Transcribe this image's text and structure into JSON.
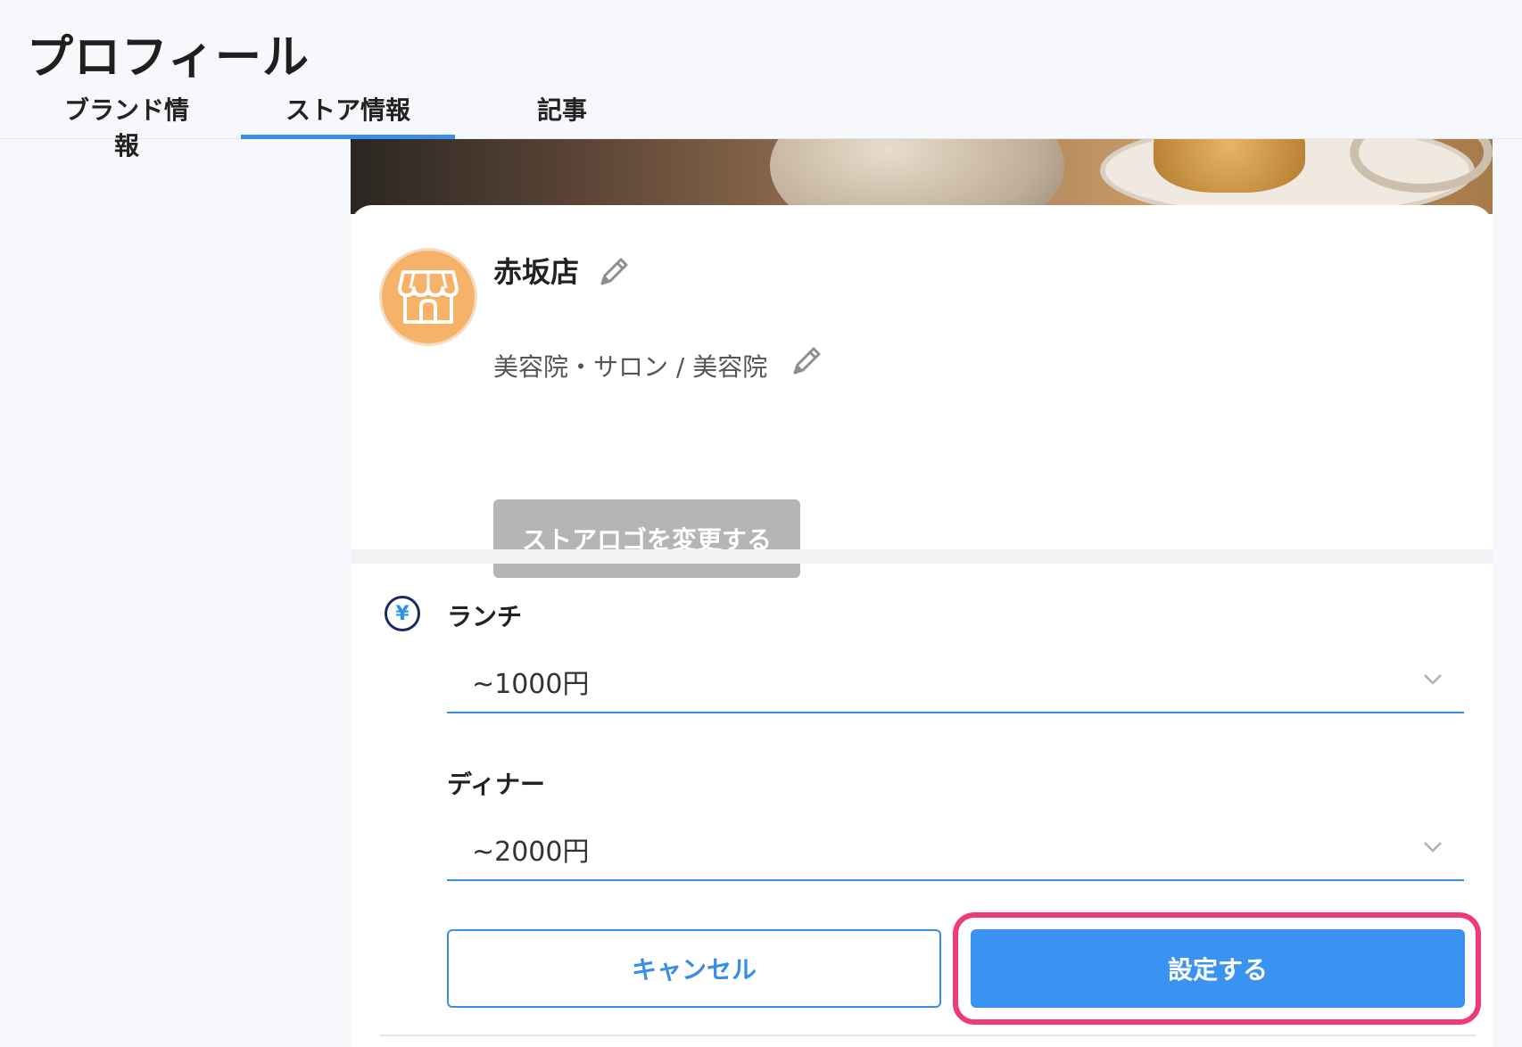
{
  "header": {
    "title": "プロフィール",
    "tabs": [
      {
        "label": "ブランド情報",
        "active": false
      },
      {
        "label": "ストア情報",
        "active": true
      },
      {
        "label": "記事",
        "active": false
      }
    ]
  },
  "store": {
    "name": "赤坂店",
    "category": "美容院・サロン / 美容院",
    "change_logo_label": "ストアロゴを変更する"
  },
  "price": {
    "icon": "yen-icon",
    "lunch_label": "ランチ",
    "lunch_value": "~1000円",
    "dinner_label": "ディナー",
    "dinner_value": "~2000円"
  },
  "actions": {
    "cancel_label": "キャンセル",
    "submit_label": "設定する"
  },
  "colors": {
    "accent": "#3a8ee6",
    "highlight": "#ef3a78",
    "avatar": "#f7b26a",
    "disabled_button": "#b5b5b5"
  }
}
